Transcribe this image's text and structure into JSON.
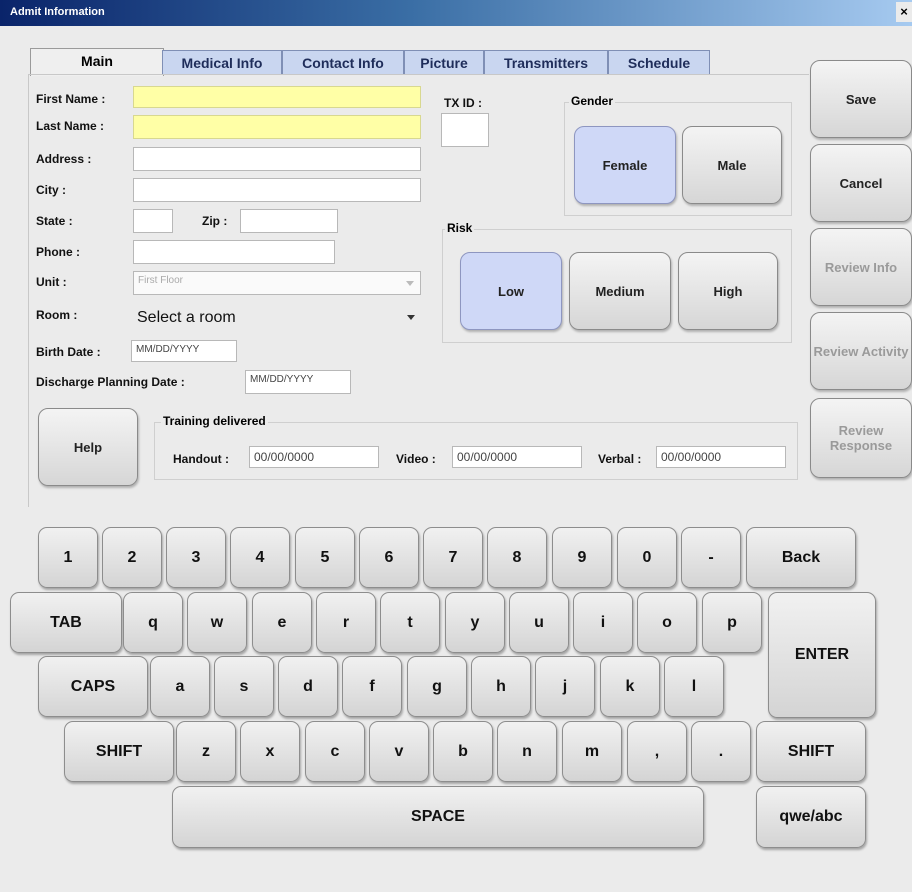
{
  "window": {
    "title": "Admit Information",
    "close": "×"
  },
  "tabs": [
    "Main",
    "Medical Info",
    "Contact Info",
    "Picture",
    "Transmitters",
    "Schedule"
  ],
  "form": {
    "first_name_label": "First Name :",
    "last_name_label": "Last Name :",
    "address_label": "Address :",
    "city_label": "City :",
    "state_label": "State :",
    "zip_label": "Zip :",
    "phone_label": "Phone :",
    "unit_label": "Unit :",
    "unit_value": "First Floor",
    "room_label": "Room :",
    "room_value": "Select a room",
    "birth_label": "Birth Date :",
    "birth_value": "MM/DD/YYYY",
    "discharge_label": "Discharge Planning Date :",
    "discharge_value": "MM/DD/YYYY",
    "txid_label": "TX ID :"
  },
  "gender": {
    "label": "Gender",
    "female": "Female",
    "male": "Male",
    "selected": "Female"
  },
  "risk": {
    "label": "Risk",
    "low": "Low",
    "medium": "Medium",
    "high": "High",
    "selected": "Low"
  },
  "training": {
    "label": "Training delivered",
    "handout_label": "Handout :",
    "handout_value": "00/00/0000",
    "video_label": "Video :",
    "video_value": "00/00/0000",
    "verbal_label": "Verbal :",
    "verbal_value": "00/00/0000"
  },
  "buttons": {
    "save": "Save",
    "cancel": "Cancel",
    "help": "Help",
    "review_info": "Review Info",
    "review_activity": "Review Activity",
    "review_response": "Review Response"
  },
  "keyboard": {
    "row1": [
      "1",
      "2",
      "3",
      "4",
      "5",
      "6",
      "7",
      "8",
      "9",
      "0",
      "-"
    ],
    "back": "Back",
    "tab": "TAB",
    "row2": [
      "q",
      "w",
      "e",
      "r",
      "t",
      "y",
      "u",
      "i",
      "o",
      "p"
    ],
    "enter": "ENTER",
    "caps": "CAPS",
    "row3": [
      "a",
      "s",
      "d",
      "f",
      "g",
      "h",
      "j",
      "k",
      "l"
    ],
    "shift": "SHIFT",
    "row4": [
      "z",
      "x",
      "c",
      "v",
      "b",
      "n",
      "m",
      ",",
      "."
    ],
    "space": "SPACE",
    "mode": "qwe/abc"
  }
}
